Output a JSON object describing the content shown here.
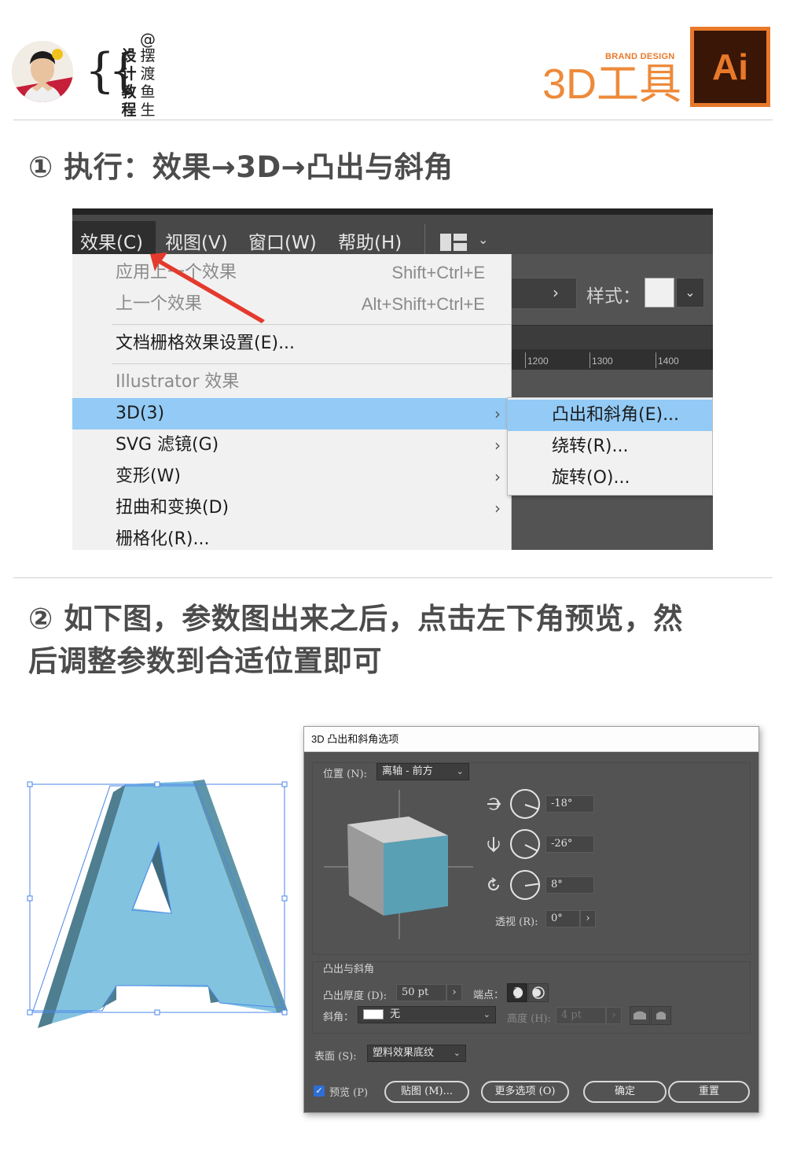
{
  "header": {
    "brackets": "{{",
    "at_sign": "@",
    "author_col1": "设计教程",
    "author_col2": "摆渡鱼生",
    "brand_small": "BRAND DESIGN",
    "brand_title": "3D工具",
    "ai_logo_text": "Ai"
  },
  "steps": {
    "step1": "① 执行：效果→3D→凸出与斜角",
    "step2_line1": "② 如下图，参数图出来之后，点击左下角预览，然",
    "step2_line2": "后调整参数到合适位置即可"
  },
  "menu_screenshot": {
    "menubar": [
      "效果(C)",
      "视图(V)",
      "窗口(W)",
      "帮助(H)"
    ],
    "style_label": "样式：",
    "ctrl_arrow": "›",
    "ruler_ticks": [
      "1200",
      "1300",
      "1400"
    ],
    "dropdown": {
      "apply_last": {
        "label": "应用上一个效果",
        "shortcut": "Shift+Ctrl+E"
      },
      "last_effect": {
        "label": "上一个效果",
        "shortcut": "Alt+Shift+Ctrl+E"
      },
      "doc_raster": "文档栅格效果设置(E)...",
      "illustrator_section": "Illustrator 效果",
      "items": [
        {
          "label": "3D(3)",
          "arrow": "›"
        },
        {
          "label": "SVG 滤镜(G)",
          "arrow": "›"
        },
        {
          "label": "变形(W)",
          "arrow": "›"
        },
        {
          "label": "扭曲和变换(D)",
          "arrow": "›"
        },
        {
          "label": "栅格化(R)..."
        }
      ]
    },
    "submenu": [
      "凸出和斜角(E)...",
      "绕转(R)...",
      "旋转(O)..."
    ]
  },
  "dialog": {
    "title": "3D 凸出和斜角选项",
    "position_label": "位置 (N):",
    "position_value": "离轴 - 前方",
    "rotation_x": "-18°",
    "rotation_y": "-26°",
    "rotation_z": "8°",
    "perspective_label": "透视 (R):",
    "perspective_value": "0°",
    "extrude_section": "凸出与斜角",
    "extrude_depth_label": "凸出厚度 (D):",
    "extrude_depth_value": "50 pt",
    "cap_label": "端点：",
    "bevel_label": "斜角：",
    "bevel_value": "无",
    "height_label": "高度 (H):",
    "height_value": "4 pt",
    "surface_label": "表面 (S):",
    "surface_value": "塑料效果底纹",
    "preview_label": "预览 (P)",
    "preview_checked": true,
    "map_button": "贴图 (M)...",
    "more_options_button": "更多选项 (O)",
    "ok_button": "确定",
    "reset_button": "重置",
    "chevron": "›",
    "caret": "⌄"
  },
  "colors": {
    "brand_orange": "#e8792a",
    "menu_highlight": "#93cbf6",
    "letter_face": "#82c3e0",
    "letter_side": "#4e7e8f",
    "cube_front": "#5aa0b5",
    "selection_blue": "#4a86e8",
    "arrow_red": "#e43a2d"
  }
}
